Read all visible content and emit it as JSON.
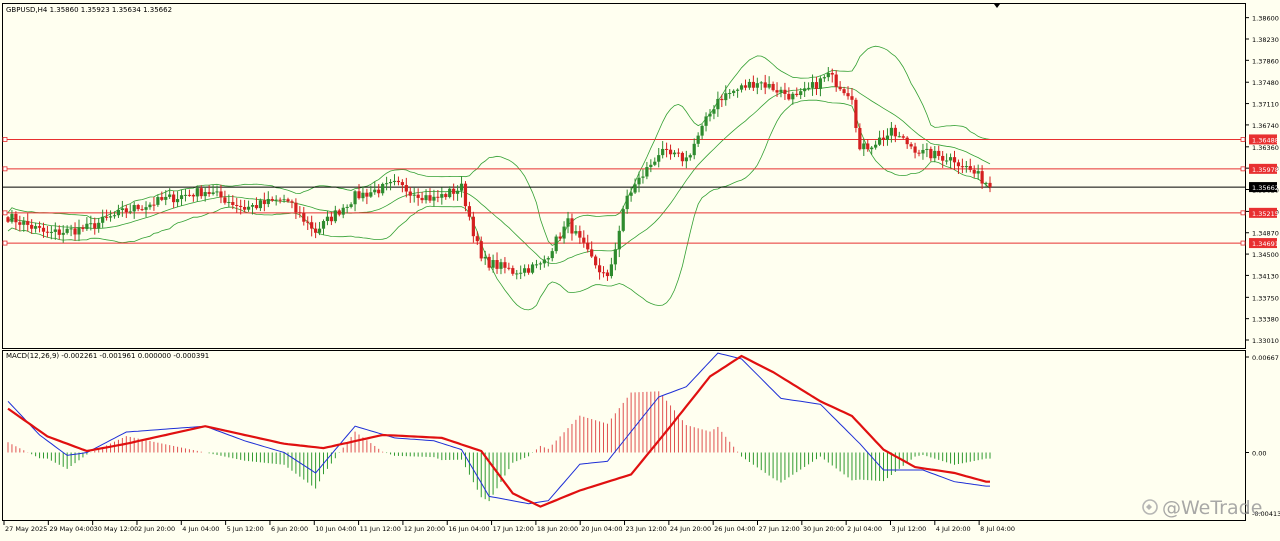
{
  "colors": {
    "background": "#fffff0",
    "bull_candle": "#2e8b2e",
    "bear_candle": "#d42020",
    "bollinger": "#33a033",
    "level_line": "#e83030",
    "price_line": "#000000",
    "macd_line": "#1e2fd6",
    "signal_line": "#e01010",
    "hist_pos": "#e05050",
    "hist_neg": "#2f9a2f"
  },
  "chart_data": [
    {
      "type": "candlestick",
      "header": "GBPUSD,H4  1.35860 1.35923 1.35634 1.35662",
      "ylim": [
        1.3301,
        1.3875
      ],
      "y_ticks": [
        "1.38600",
        "1.38230",
        "1.37860",
        "1.37480",
        "1.37110",
        "1.36740",
        "1.36360",
        "1.35990",
        "1.35620",
        "1.35240",
        "1.34870",
        "1.34500",
        "1.34130",
        "1.33750",
        "1.33380",
        "1.33010"
      ],
      "levels": [
        {
          "label": "1.36488",
          "value": 1.36488,
          "color": "#e83030"
        },
        {
          "label": "1.35978",
          "value": 1.35978,
          "color": "#e83030"
        },
        {
          "label": "1.35215",
          "value": 1.35215,
          "color": "#e83030"
        },
        {
          "label": "1.34691",
          "value": 1.34691,
          "color": "#e83030"
        }
      ],
      "current_price": {
        "label": "1.35662",
        "value": 1.35662
      },
      "close_anchors": [
        [
          0,
          1.3515
        ],
        [
          10,
          1.3485
        ],
        [
          20,
          1.3495
        ],
        [
          30,
          1.3525
        ],
        [
          40,
          1.3545
        ],
        [
          50,
          1.356
        ],
        [
          60,
          1.353
        ],
        [
          70,
          1.3545
        ],
        [
          78,
          1.349
        ],
        [
          88,
          1.355
        ],
        [
          98,
          1.357
        ],
        [
          108,
          1.3545
        ],
        [
          115,
          1.3565
        ],
        [
          120,
          1.344
        ],
        [
          128,
          1.342
        ],
        [
          135,
          1.343
        ],
        [
          142,
          1.3505
        ],
        [
          147,
          1.345
        ],
        [
          152,
          1.3405
        ],
        [
          157,
          1.355
        ],
        [
          165,
          1.3625
        ],
        [
          172,
          1.3615
        ],
        [
          180,
          1.372
        ],
        [
          190,
          1.375
        ],
        [
          200,
          1.372
        ],
        [
          208,
          1.376
        ],
        [
          214,
          1.3725
        ],
        [
          216,
          1.363
        ],
        [
          224,
          1.366
        ],
        [
          232,
          1.3625
        ],
        [
          240,
          1.3615
        ],
        [
          248,
          1.3575
        ]
      ]
    },
    {
      "type": "macd",
      "header": "MACD(12,26,9) -0.002261 -0.001961 0.000000 -0.000391",
      "ylim": [
        -0.004139,
        0.00667
      ],
      "y_ticks": [
        "0.00667",
        "0.00",
        "-0.004139"
      ],
      "macd_anchors": [
        [
          0,
          0.0035
        ],
        [
          8,
          0.0012
        ],
        [
          15,
          -0.0002
        ],
        [
          20,
          0.0
        ],
        [
          30,
          0.0014
        ],
        [
          40,
          0.0016
        ],
        [
          50,
          0.0018
        ],
        [
          60,
          0.0008
        ],
        [
          70,
          0.0
        ],
        [
          78,
          -0.0014
        ],
        [
          88,
          0.0018
        ],
        [
          98,
          0.001
        ],
        [
          108,
          0.0008
        ],
        [
          115,
          0.0002
        ],
        [
          122,
          -0.003
        ],
        [
          132,
          -0.0035
        ],
        [
          137,
          -0.0033
        ],
        [
          145,
          -0.0008
        ],
        [
          152,
          -0.0006
        ],
        [
          165,
          0.0038
        ],
        [
          172,
          0.0045
        ],
        [
          180,
          0.0068
        ],
        [
          186,
          0.0064
        ],
        [
          196,
          0.0037
        ],
        [
          206,
          0.0033
        ],
        [
          216,
          0.0006
        ],
        [
          222,
          -0.0012
        ],
        [
          232,
          -0.0012
        ],
        [
          240,
          -0.002
        ],
        [
          248,
          -0.0023
        ]
      ],
      "signal_anchors": [
        [
          0,
          0.003
        ],
        [
          10,
          0.0011
        ],
        [
          20,
          0.0001
        ],
        [
          30,
          0.0006
        ],
        [
          40,
          0.0012
        ],
        [
          50,
          0.0018
        ],
        [
          60,
          0.0012
        ],
        [
          70,
          0.0006
        ],
        [
          80,
          0.0003
        ],
        [
          95,
          0.0012
        ],
        [
          110,
          0.001
        ],
        [
          120,
          0.0001
        ],
        [
          128,
          -0.0028
        ],
        [
          135,
          -0.0037
        ],
        [
          145,
          -0.0026
        ],
        [
          158,
          -0.0015
        ],
        [
          168,
          0.0018
        ],
        [
          178,
          0.0052
        ],
        [
          186,
          0.0066
        ],
        [
          194,
          0.0055
        ],
        [
          206,
          0.0035
        ],
        [
          214,
          0.0025
        ],
        [
          222,
          0.0002
        ],
        [
          230,
          -0.001
        ],
        [
          240,
          -0.0014
        ],
        [
          248,
          -0.002
        ]
      ]
    }
  ],
  "x_labels": [
    "27 May 2025",
    "29 May 04:00",
    "30 May 12:00",
    "2 Jun 20:00",
    "4 Jun 04:00",
    "5 Jun 12:00",
    "6 Jun 20:00",
    "10 Jun 04:00",
    "11 Jun 12:00",
    "12 Jun 20:00",
    "16 Jun 04:00",
    "17 Jun 12:00",
    "18 Jun 20:00",
    "20 Jun 04:00",
    "23 Jun 12:00",
    "24 Jun 20:00",
    "26 Jun 04:00",
    "27 Jun 12:00",
    "30 Jun 20:00",
    "2 Jul 04:00",
    "3 Jul 12:00",
    "4 Jul 20:00",
    "8 Jul 04:00"
  ],
  "watermark": "@WeTrade"
}
